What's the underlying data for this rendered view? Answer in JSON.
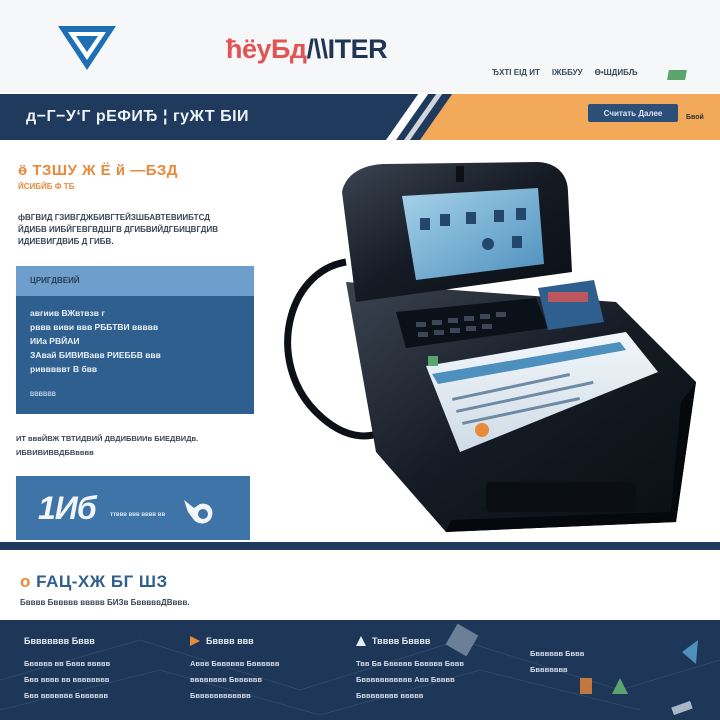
{
  "header": {
    "brand_part1": "ħёуБд",
    "brand_part2": "/\\\\ITER",
    "nav": [
      "ЂХТІ ЕІД ИТ",
      "ІЖББУУ",
      "Ө•ШДИБЉ"
    ]
  },
  "banner": {
    "title": "д−Г−У‘Г рЕФИЂ ¦ гуЖТ БІИ",
    "button_label": "Считать Далее",
    "link_label": "Бвой"
  },
  "hero": {
    "heading": "ӫ ТЗШУ Ж Ё й —БЗД",
    "subheading": "ЙСИБЙБ Ф ТБ",
    "body": [
      "фВГВИД ГЗИВГДЖБИВГТЕЙЗШБАВТЕВИИБТСД",
      "ЙДИБВ ИИБЙГЕВГВДШГВ ДГИБВИЙДГБИЦВГДИВ",
      "ИДИЕВИГДВИБ Д ГИБВ."
    ]
  },
  "feature_card": {
    "header": "ЦРИГДВЕИЙ",
    "lines": [
      "авгиив ВЖвтвзв г",
      "рввв виви ввв РББТВИ ввввв",
      "ИИа РВЙАИ",
      "ЗАвай БИВИВавв РИЕББВ ввв",
      "ривввввт В бвв"
    ],
    "footer": "ВВВВВВ"
  },
  "note": [
    "ИТ вввЙВЖ ТВТИДВИЙ ДВДИБВИИв БИЕДВИДв.",
    "ИБВИВИВВДБВвввв"
  ],
  "stat": {
    "number": "1Иб",
    "label": "ттввв ввв вввв вв"
  },
  "section2": {
    "title_lead": "o",
    "title": "FAЦ-ХЖ БГ ШЗ",
    "subtitle": "Бвввв Бввввв ввввв БИЗв БвввввДВввв."
  },
  "footer": {
    "columns": [
      {
        "title": "Бввввввв Бввв",
        "lines": [
          "Бввввв вв Бввв ввввв",
          "Бвв вввв вв вввввввв",
          "Бвв ввввввв Бвввввв"
        ]
      },
      {
        "title": "Бвввв ввв",
        "lines": [
          "Аввв Бвввввв Бвввввв",
          "вввввввв Бвввввв",
          "Бвввввввввввв"
        ]
      },
      {
        "title": "Твввв Бвввв",
        "lines": [
          "Твв Бв Бввввв Бввввв Бввв",
          "Бввввввввввв Авв Бвввв",
          "Бвввввввв ввввв"
        ]
      },
      {
        "title": "",
        "lines": [
          "Бвввввв Бввв",
          "Бввввввв",
          ""
        ]
      }
    ]
  },
  "colors": {
    "navy": "#1f3a5c",
    "orange": "#f3a95a",
    "blue": "#3f74a8",
    "light_blue": "#6e9fcc"
  }
}
